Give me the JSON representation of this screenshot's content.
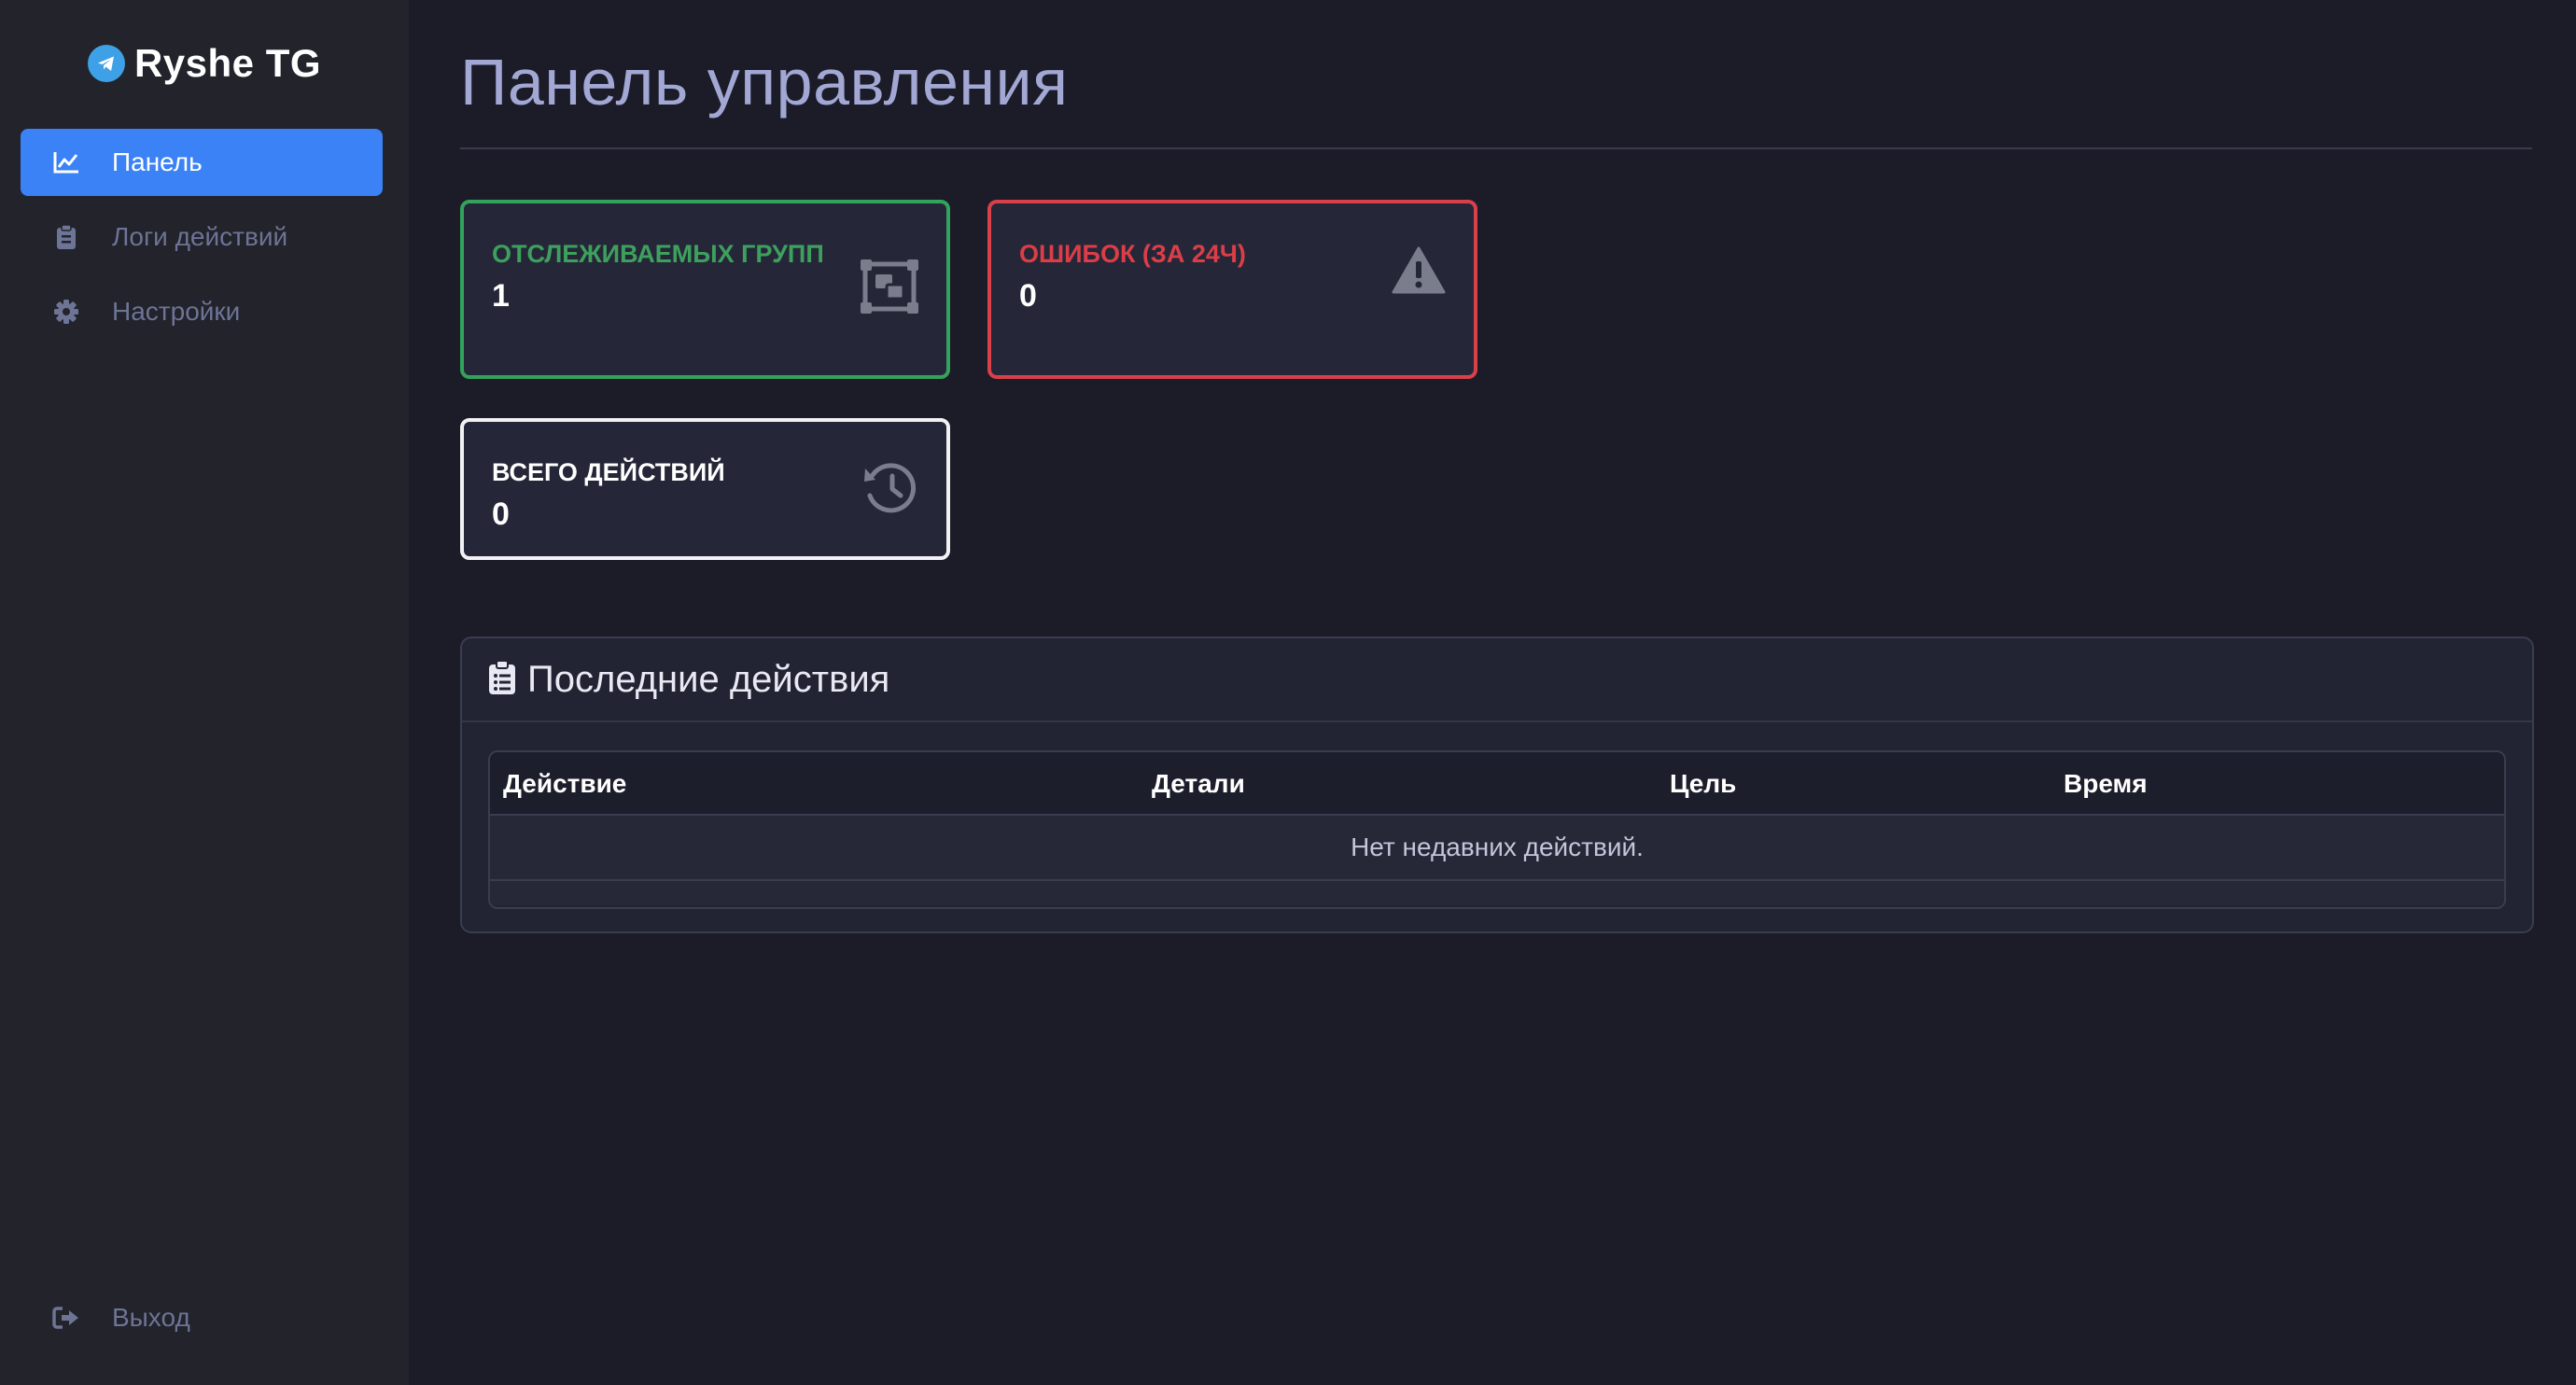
{
  "brand": {
    "title": "Ryshe TG",
    "icon": "telegram-icon",
    "color": "#3ea0e6"
  },
  "sidebar": {
    "items": [
      {
        "label": "Панель",
        "icon": "chart-line-icon",
        "active": true
      },
      {
        "label": "Логи действий",
        "icon": "clipboard-icon",
        "active": false
      },
      {
        "label": "Настройки",
        "icon": "gear-icon",
        "active": false
      }
    ],
    "logout": {
      "label": "Выход",
      "icon": "sign-out-icon"
    }
  },
  "main": {
    "title": "Панель управления",
    "cards": [
      {
        "label": "ОТСЛЕЖИВАЕМЫХ ГРУПП",
        "value": "1",
        "icon": "group-icon",
        "color": "#33a35c"
      },
      {
        "label": "ОШИБОК (ЗА 24Ч)",
        "value": "0",
        "icon": "warning-icon",
        "color": "#d8404a"
      },
      {
        "label": "ВСЕГО ДЕЙСТВИЙ",
        "value": "0",
        "icon": "history-icon",
        "color": "#f2f2f5"
      }
    ],
    "recent": {
      "title": "Последние действия",
      "icon": "clipboard-list-icon",
      "columns": [
        "Действие",
        "Детали",
        "Цель",
        "Время"
      ],
      "empty_text": "Нет недавних действий."
    }
  },
  "colors": {
    "accent": "#3a82f6",
    "background": "#1b1c27",
    "sidebar": "#22232b"
  }
}
